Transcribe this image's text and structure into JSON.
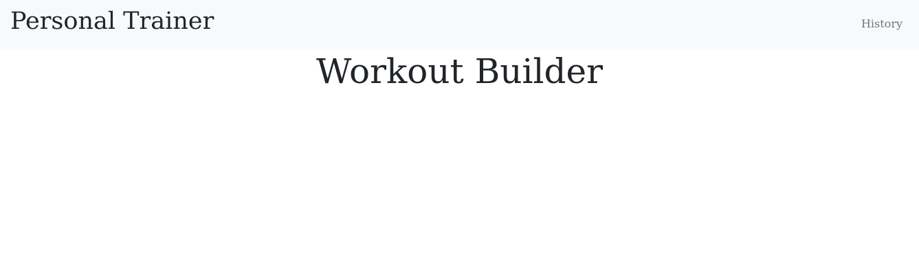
{
  "navbar": {
    "brand": "Personal Trainer",
    "links": [
      {
        "label": "History"
      }
    ]
  },
  "main": {
    "title": "Workout Builder"
  },
  "colors": {
    "navbar_background": "#f8f9fa",
    "text": "#212529",
    "muted_link": "#6c757d",
    "page_background": "#ffffff"
  }
}
